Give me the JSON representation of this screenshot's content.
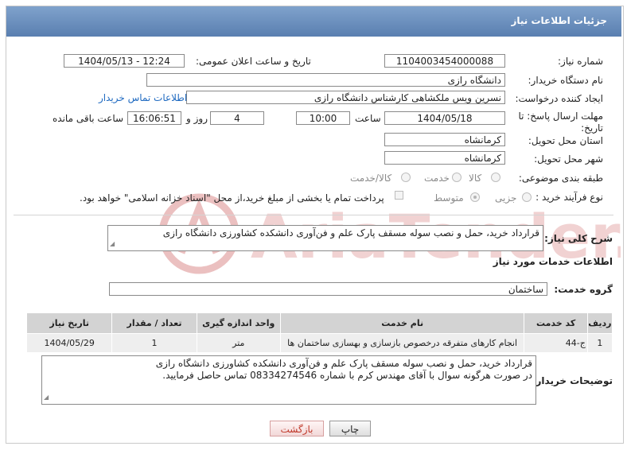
{
  "header": {
    "title": "جزئیات اطلاعات نیاز"
  },
  "fields": {
    "need_number": {
      "label": "شماره نیاز:",
      "value": "1104003454000088"
    },
    "announce_datetime": {
      "label": "تاریخ و ساعت اعلان عمومی:",
      "value": "1404/05/13 - 12:24"
    },
    "buyer_org": {
      "label": "نام دستگاه خریدار:",
      "value": "دانشگاه رازی"
    },
    "creator": {
      "label": "ایجاد کننده درخواست:",
      "value": "نسرین ویس ملکشاهی کارشناس دانشگاه رازی",
      "contact_link": "اطلاعات تماس خریدار"
    },
    "deadline": {
      "label": "مهلت ارسال پاسخ: تا تاریخ:",
      "date": "1404/05/18",
      "time_label": "ساعت",
      "time": "10:00",
      "days": "4",
      "days_label": "روز و",
      "remaining": "16:06:51",
      "remaining_label": "ساعت باقی مانده"
    },
    "province": {
      "label": "استان محل تحویل:",
      "value": "کرمانشاه"
    },
    "city": {
      "label": "شهر محل تحویل:",
      "value": "کرمانشاه"
    },
    "category": {
      "label": "طبقه بندی موضوعی:",
      "options": [
        "کالا",
        "خدمت",
        "کالا/خدمت"
      ]
    },
    "purchase_type": {
      "label": "نوع فرآیند خرید :",
      "options": [
        "جزیی",
        "متوسط"
      ],
      "selected": "متوسط",
      "payment_note": "پرداخت تمام یا بخشی از مبلغ خرید،از محل \"اسناد خزانه اسلامی\" خواهد بود."
    }
  },
  "summary": {
    "label": "شرح کلی نیاز:",
    "value": "قرارداد خرید، حمل و نصب سوله مسقف پارک علم و فن‌آوری دانشکده کشاورزی دانشگاه رازی"
  },
  "services": {
    "section_title": "اطلاعات خدمات مورد نیاز",
    "group_label": "گروه خدمت:",
    "group_value": "ساختمان",
    "columns": [
      "ردیف",
      "کد خدمت",
      "نام خدمت",
      "واحد اندازه گیری",
      "تعداد / مقدار",
      "تاریخ نیاز"
    ],
    "rows": [
      [
        "1",
        "ج-44",
        "انجام کارهای متفرقه درخصوص بازسازی و بهسازی ساختمان ها",
        "متر",
        "1",
        "1404/05/29"
      ]
    ]
  },
  "buyer_notes": {
    "label": "توضیحات خریدار:",
    "line1": "قرارداد خرید، حمل و نصب سوله مسقف پارک علم و فن‌آوری دانشکده کشاورزی دانشگاه رازی",
    "line2": "در صورت هرگونه سوال با آقای مهندس کرم با شماره 08334274546 تماس حاصل فرمایید."
  },
  "buttons": {
    "print": "چاپ",
    "back": "بازگشت"
  },
  "watermark_text": "AriaTender.neT",
  "colors": {
    "header": "#5a7fb0",
    "link": "#1f6ac1",
    "watermark": "#e8b8b8"
  }
}
